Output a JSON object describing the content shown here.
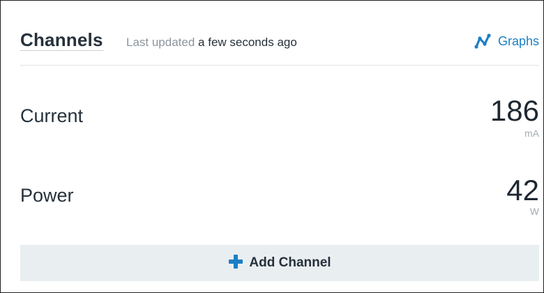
{
  "header": {
    "title": "Channels",
    "updated_prefix": "Last updated",
    "updated_time": "a few seconds ago",
    "graphs_label": "Graphs",
    "graphs_icon": "line-graph-icon"
  },
  "channels": [
    {
      "name": "Current",
      "value": "186",
      "unit": "mA"
    },
    {
      "name": "Power",
      "value": "42",
      "unit": "W"
    }
  ],
  "footer": {
    "add_label": "Add Channel",
    "add_icon": "plus-icon"
  },
  "colors": {
    "accent": "#1b7fc4",
    "text": "#26313b",
    "muted": "#8c959e",
    "bar_bg": "#e9eef1",
    "divider": "#dde3e8"
  }
}
